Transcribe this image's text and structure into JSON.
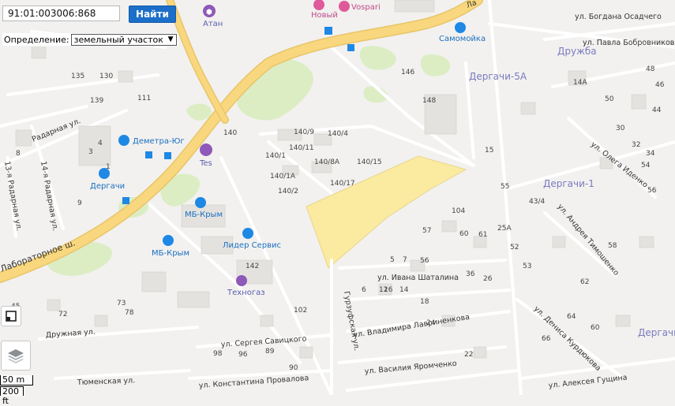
{
  "search": {
    "value": "91:01:003006:868",
    "button_label": "Найти"
  },
  "definition": {
    "label": "Определение:",
    "selected": "земельный участок"
  },
  "scale": {
    "primary": "50 m",
    "secondary": "200 ft"
  },
  "colors": {
    "highlight_parcel": "#fbeba0",
    "major_road": "#f9d77e",
    "water_icon": "#1e88e5",
    "poi_purple": "#8e59b8",
    "poi_pink": "#e05a9b"
  },
  "poi": [
    {
      "label": "Атан",
      "icon": "shopping-icon"
    },
    {
      "label": "Новый",
      "icon": "cart-icon"
    },
    {
      "label": "Vospari",
      "icon": "bag-icon"
    },
    {
      "label": "Самомойка",
      "icon": "carwash-icon"
    },
    {
      "label": "Деметра-Юг",
      "icon": "shop-icon"
    },
    {
      "label": "Tes",
      "icon": "gas-station-icon"
    },
    {
      "label": "Дергачи",
      "icon": "car-service-icon"
    },
    {
      "label": "МБ-Крым",
      "icon": "car-service-icon"
    },
    {
      "label": "МБ-Крым",
      "icon": "car-service-icon"
    },
    {
      "label": "Лидер Сервис",
      "icon": "car-service-icon"
    },
    {
      "label": "Техногаз",
      "icon": "gas-icon"
    }
  ],
  "districts": [
    "Дружба",
    "Дергачи-5А",
    "Дергачи-1",
    "Дергачи"
  ],
  "streets": [
    "ул. Богдана Осадчего",
    "ул. Павла Бобровникова",
    "ул. Олега Иденко",
    "ул. Андрея Тимошенко",
    "ул. Ивана Шаталина",
    "ул. Владимира Лавриненкова",
    "ул. Дениса Курдюкова",
    "ул. Сергея Савицкого",
    "ул. Константина Провалова",
    "ул. Василия Яромченко",
    "ул. Алексея Гущина",
    "Дружная ул.",
    "Тюменская ул.",
    "Гурзуфская ул.",
    "Лабораторное ш.",
    "Радарная ул.",
    "13-я Радарная ул.",
    "14-я Радарная ул.",
    "Ла"
  ],
  "house_numbers": [
    "140/9",
    "140/4",
    "140/11",
    "140/1",
    "140/8А",
    "140/15",
    "140/1А",
    "140/2",
    "140/17",
    "140",
    "148",
    "146",
    "142",
    "135",
    "130",
    "139",
    "111",
    "104",
    "102",
    "15",
    "14А",
    "25А",
    "55",
    "57",
    "60",
    "61",
    "56",
    "53",
    "52",
    "43/4",
    "36",
    "26",
    "24",
    "22",
    "98",
    "96",
    "90",
    "89",
    "78",
    "73",
    "72",
    "45",
    "1",
    "3",
    "4",
    "5",
    "6",
    "7",
    "8",
    "9",
    "12",
    "14",
    "16",
    "18",
    "30",
    "32",
    "34",
    "44",
    "46",
    "48",
    "50",
    "54",
    "56",
    "58",
    "60",
    "62",
    "64",
    "66"
  ]
}
